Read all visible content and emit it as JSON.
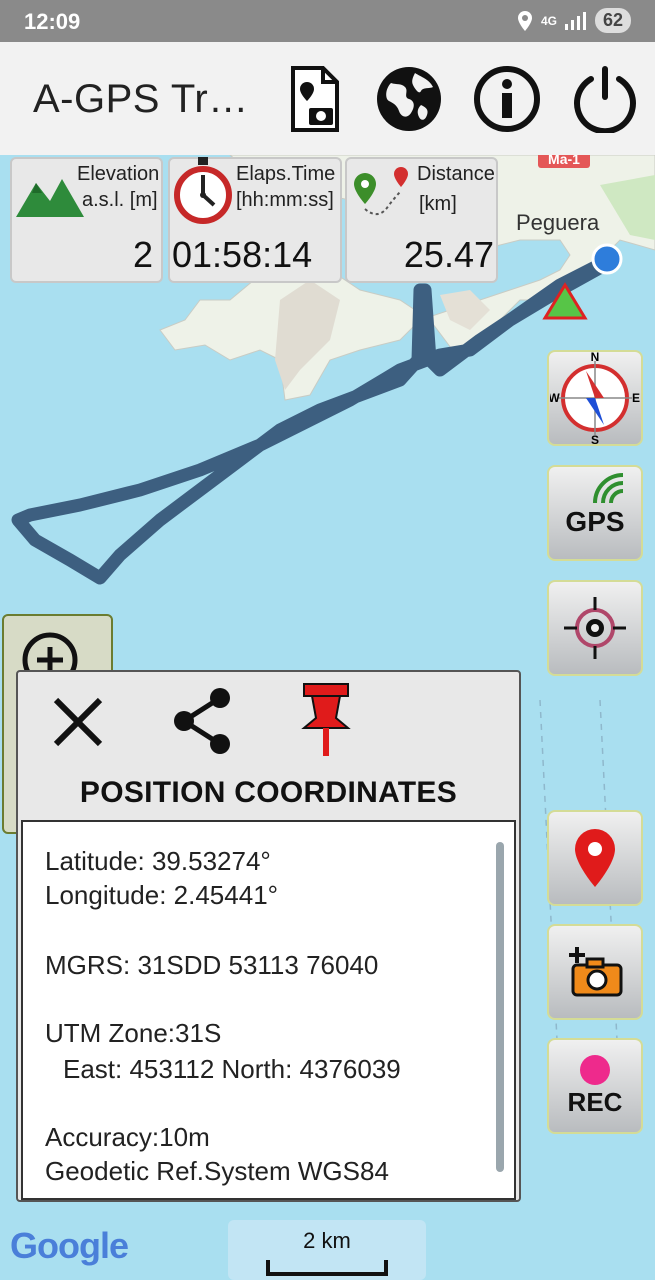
{
  "status_bar": {
    "time": "12:09",
    "network": "4G",
    "battery": "62"
  },
  "app_bar": {
    "title": "A-GPS Tr…",
    "icons": [
      "photo-doc-icon",
      "globe-icon",
      "info-icon",
      "power-icon"
    ]
  },
  "panels": {
    "elevation": {
      "label_line1": "Elevation",
      "label_line2": "a.s.l. [m]",
      "value": "2"
    },
    "elapsed": {
      "label_line1": "Elaps.Time",
      "label_line2": "[hh:mm:ss]",
      "value": "01:58:14"
    },
    "distance": {
      "label_line1": "Distance",
      "label_line2": "[km]",
      "value": "25.47"
    }
  },
  "map": {
    "place_label": "Peguera",
    "road_label": "Ma-1",
    "compass": {
      "n": "N",
      "s": "S",
      "e": "E",
      "w": "W"
    },
    "gps_label": "GPS",
    "rec_label": "REC",
    "google_logo": "Google",
    "scale_label": "2 km"
  },
  "dialog": {
    "title": "POSITION COORDINATES",
    "latitude": "Latitude: 39.53274°",
    "longitude": "Longitude: 2.45441°",
    "mgrs": "MGRS: 31SDD 53113 76040",
    "utm_zone": "UTM Zone:31S",
    "utm_coords": "East: 453112 North: 4376039",
    "accuracy": "Accuracy:10m",
    "geodetic": "Geodetic Ref.System WGS84"
  },
  "colors": {
    "track": "#3d5f80",
    "map_water": "#a9dff0",
    "location_dot": "#2e7ddb",
    "pin_red": "#e01b1b"
  }
}
